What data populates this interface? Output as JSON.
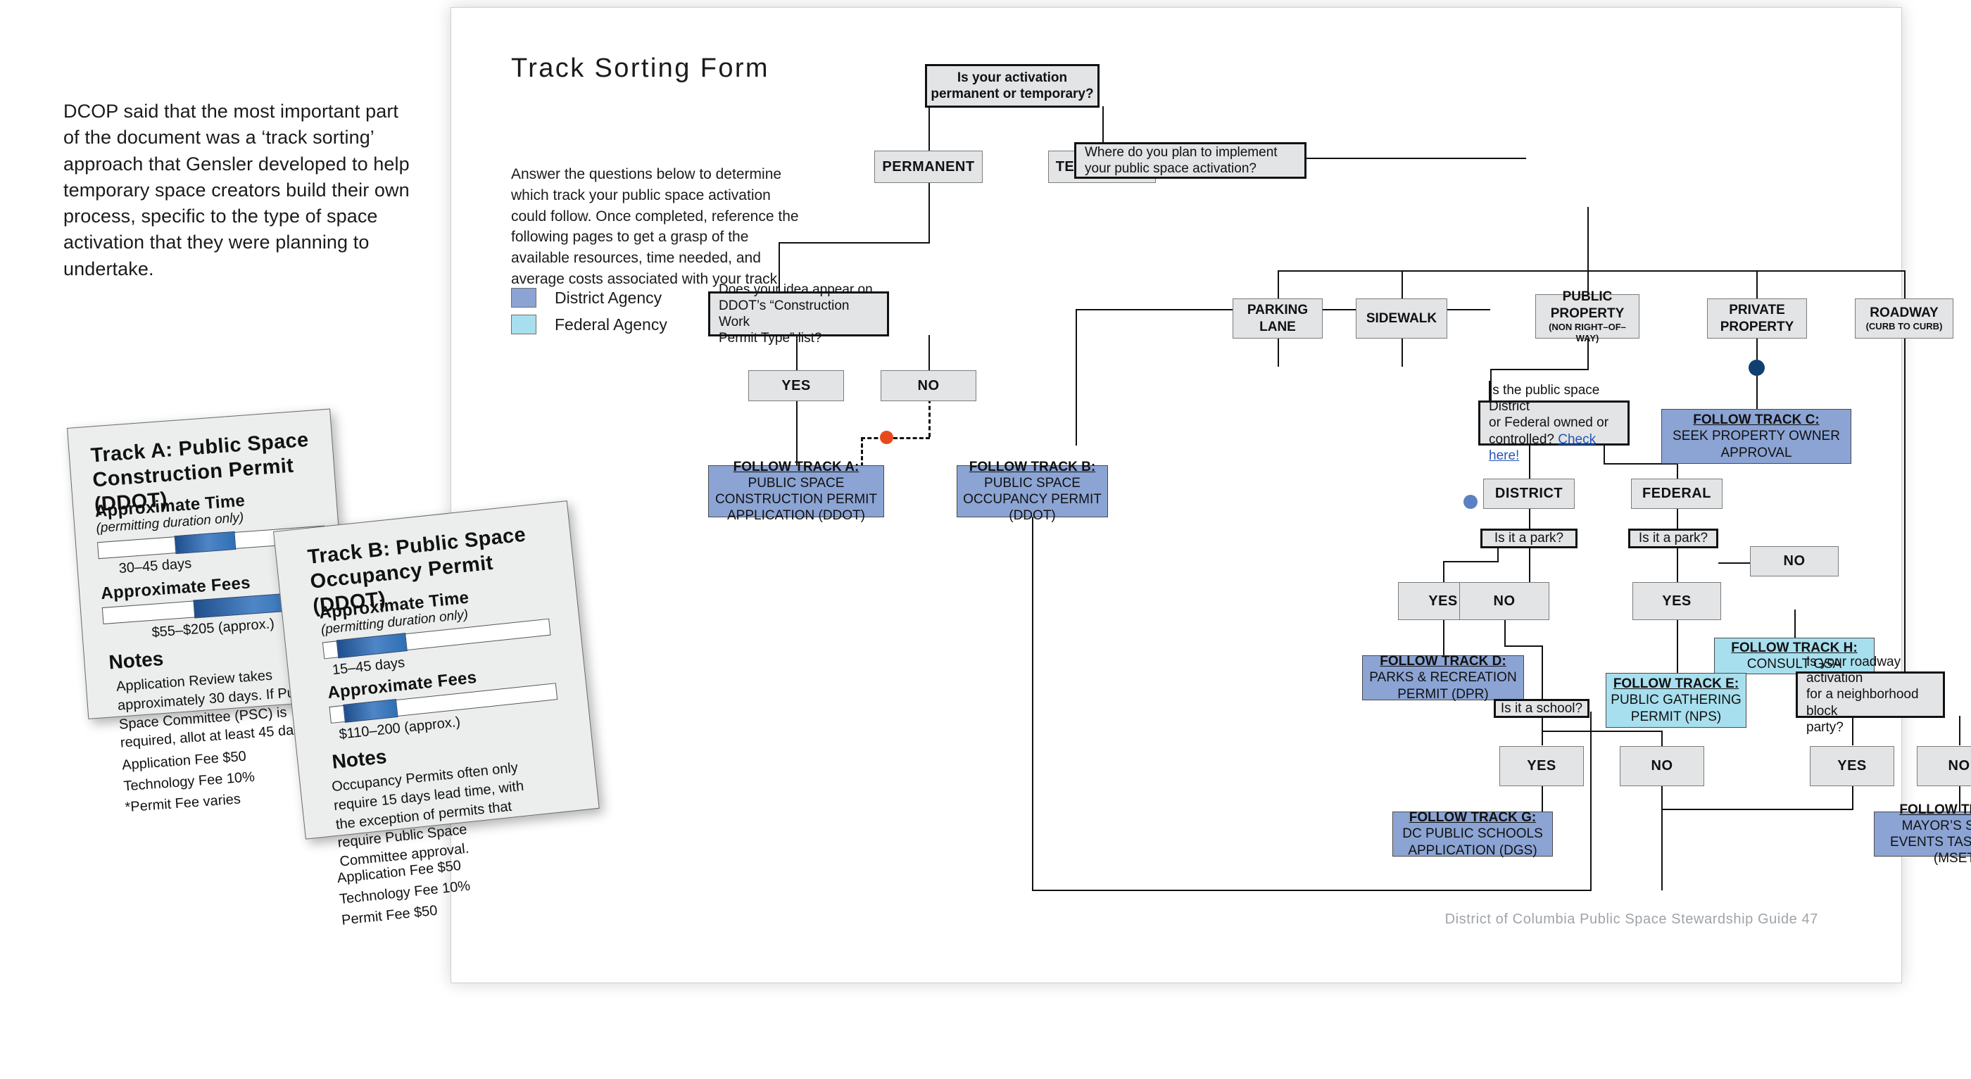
{
  "intro_paragraph": "DCOP said that the most important part of the document was a ‘track sorting’ approach that Gensler developed to help temporary space creators build their own process, specific to the type of space activation that they were planning to undertake.",
  "page": {
    "form_title": "Track Sorting Form",
    "form_intro": "Answer the questions below to determine which track your public space activation could follow. Once completed, reference the following pages to get a grasp of the available resources, time needed, and average costs associated with your track!",
    "footer": "District of Columbia Public Space Stewardship Guide   47"
  },
  "legend": {
    "items": [
      {
        "label": "District Agency",
        "color": "#8ba4d4"
      },
      {
        "label": "Federal Agency",
        "color": "#a8dfee"
      }
    ]
  },
  "chart_data": {
    "type": "diagram",
    "title": "Track Sorting Form",
    "nodes": {
      "q_root": "Is your activation permanent or temporary?",
      "permanent": "PERMANENT",
      "temporary": "TEMPORARY",
      "q_ddot_line1": "Does your idea appear on",
      "q_ddot_line2": "DDOT’s “Construction Work",
      "q_ddot_line3": "Permit Type” list?",
      "ddot_yes": "YES",
      "ddot_no": "NO",
      "q_where_line1": "Where do you plan to implement",
      "q_where_line2": "your public space activation?",
      "loc_parking": "PARKING LANE",
      "loc_sidewalk": "SIDEWALK",
      "loc_public": "PUBLIC PROPERTY",
      "loc_public_sub": "(NON RIGHT–OF–WAY)",
      "loc_private": "PRIVATE PROPERTY",
      "loc_roadway": "ROADWAY",
      "loc_roadway_sub": "(CURB TO CURB)",
      "q_owner_line1": "Is the public space District",
      "q_owner_line2": "or Federal owned or",
      "q_owner_line3": "controlled?",
      "q_owner_link": "Check here!",
      "district": "DISTRICT",
      "federal": "FEDERAL",
      "q_park_district": "Is it a park?",
      "q_park_federal": "Is it a park?",
      "dist_park_yes": "YES",
      "dist_park_no": "NO",
      "fed_park_yes": "YES",
      "fed_park_no": "NO",
      "q_school": "Is it a school?",
      "school_yes": "YES",
      "school_no": "NO",
      "q_block_line1": "Is your roadway activation",
      "q_block_line2": "for a neighborhood block",
      "q_block_line3": "party?",
      "block_yes": "YES",
      "block_no": "NO"
    },
    "tracks": [
      {
        "id": "A",
        "head": "FOLLOW TRACK A:",
        "body": "PUBLIC SPACE CONSTRUCTION PERMIT APPLICATION (DDOT)",
        "agency": "district"
      },
      {
        "id": "B",
        "head": "FOLLOW TRACK B:",
        "body": "PUBLIC SPACE OCCUPANCY PERMIT (DDOT)",
        "agency": "district"
      },
      {
        "id": "C",
        "head": "FOLLOW TRACK C:",
        "body": "SEEK PROPERTY OWNER APPROVAL",
        "agency": "district"
      },
      {
        "id": "D",
        "head": "FOLLOW TRACK D:",
        "body": "PARKS & RECREATION PERMIT (DPR)",
        "agency": "district"
      },
      {
        "id": "E",
        "head": "FOLLOW TRACK E:",
        "body": "PUBLIC GATHERING PERMIT (NPS)",
        "agency": "federal"
      },
      {
        "id": "F",
        "head": "FOLLOW TRACK F:",
        "body": "MAYOR’S SPECIAL EVENTS TASK GROUP (MSETG)",
        "agency": "district"
      },
      {
        "id": "G",
        "head": "FOLLOW TRACK G:",
        "body": "DC PUBLIC SCHOOLS APPLICATION (DGS)",
        "agency": "district"
      },
      {
        "id": "H",
        "head": "FOLLOW TRACK H:",
        "body": "CONSULT GSA",
        "agency": "federal"
      }
    ],
    "markers": [
      {
        "name": "orange-connector-dot",
        "color": "#e8491c"
      },
      {
        "name": "navy-connector-dot",
        "color": "#123f72"
      },
      {
        "name": "blue-connector-dot",
        "color": "#5b81c4"
      }
    ]
  },
  "track_a_card": {
    "title": "Track A: Public Space Construction Permit (DDOT)",
    "time_heading": "Approximate Time",
    "time_sub": "(permitting duration only)",
    "time_value": "30–45 days",
    "fees_heading": "Approximate Fees",
    "fees_value": "$55–$205 (approx.)",
    "notes_heading": "Notes",
    "notes_body": "Application Review takes approximately 30 days. If Public Space Committee (PSC) is required, allot at least 45 days.",
    "fee_lines": [
      "Application Fee $50",
      "Technology Fee 10%",
      "*Permit Fee varies"
    ]
  },
  "track_b_card": {
    "title": "Track B: Public Space Occupancy Permit (DDOT)",
    "time_heading": "Approximate Time",
    "time_sub": "(permitting duration only)",
    "time_value": "15–45 days",
    "fees_heading": "Approximate Fees",
    "fees_value": "$110–200 (approx.)",
    "notes_heading": "Notes",
    "notes_body": "Occupancy Permits often only require 15 days lead time, with the exception of permits that require Public Space Committee approval.",
    "fee_lines": [
      "Application Fee $50",
      "Technology Fee 10%",
      "Permit Fee $50"
    ]
  }
}
